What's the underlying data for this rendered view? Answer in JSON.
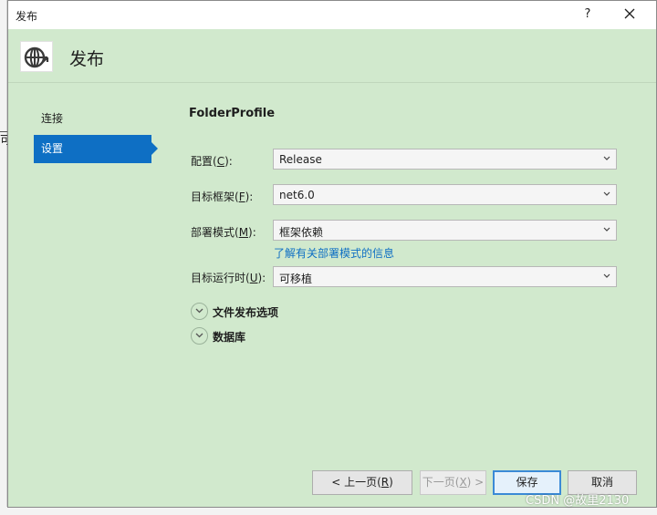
{
  "background": {
    "partial_glyph": "可"
  },
  "window": {
    "title": "发布",
    "help_label": "?",
    "close_label": "✕"
  },
  "header": {
    "icon": "globe-publish-icon",
    "title": "发布"
  },
  "nav": {
    "items": [
      {
        "label": "连接"
      },
      {
        "label": "设置"
      }
    ],
    "active_index": 1
  },
  "settings": {
    "profile_name": "FolderProfile",
    "fields": [
      {
        "label_prefix": "配置(",
        "mnemonic": "C",
        "label_suffix": "):",
        "value": "Release"
      },
      {
        "label_prefix": "目标框架(",
        "mnemonic": "F",
        "label_suffix": "):",
        "value": "net6.0"
      },
      {
        "label_prefix": "部署模式(",
        "mnemonic": "M",
        "label_suffix": "):",
        "value": "框架依赖"
      },
      {
        "label_prefix": "目标运行时(",
        "mnemonic": "U",
        "label_suffix": "):",
        "value": "可移植"
      }
    ],
    "deploy_mode_link": "了解有关部署模式的信息",
    "sections": [
      {
        "label": "文件发布选项"
      },
      {
        "label": "数据库"
      }
    ]
  },
  "buttons": {
    "prev": {
      "prefix": "< 上一页(",
      "mnemonic": "R",
      "suffix": ")"
    },
    "next": {
      "prefix": "下一页(",
      "mnemonic": "X",
      "suffix": ") >"
    },
    "save": "保存",
    "cancel": "取消"
  },
  "watermark": "CSDN @故里2130",
  "colors": {
    "accent": "#0e6fc4",
    "panel_bg": "#d1e9cd",
    "link": "#0e6fc4"
  }
}
